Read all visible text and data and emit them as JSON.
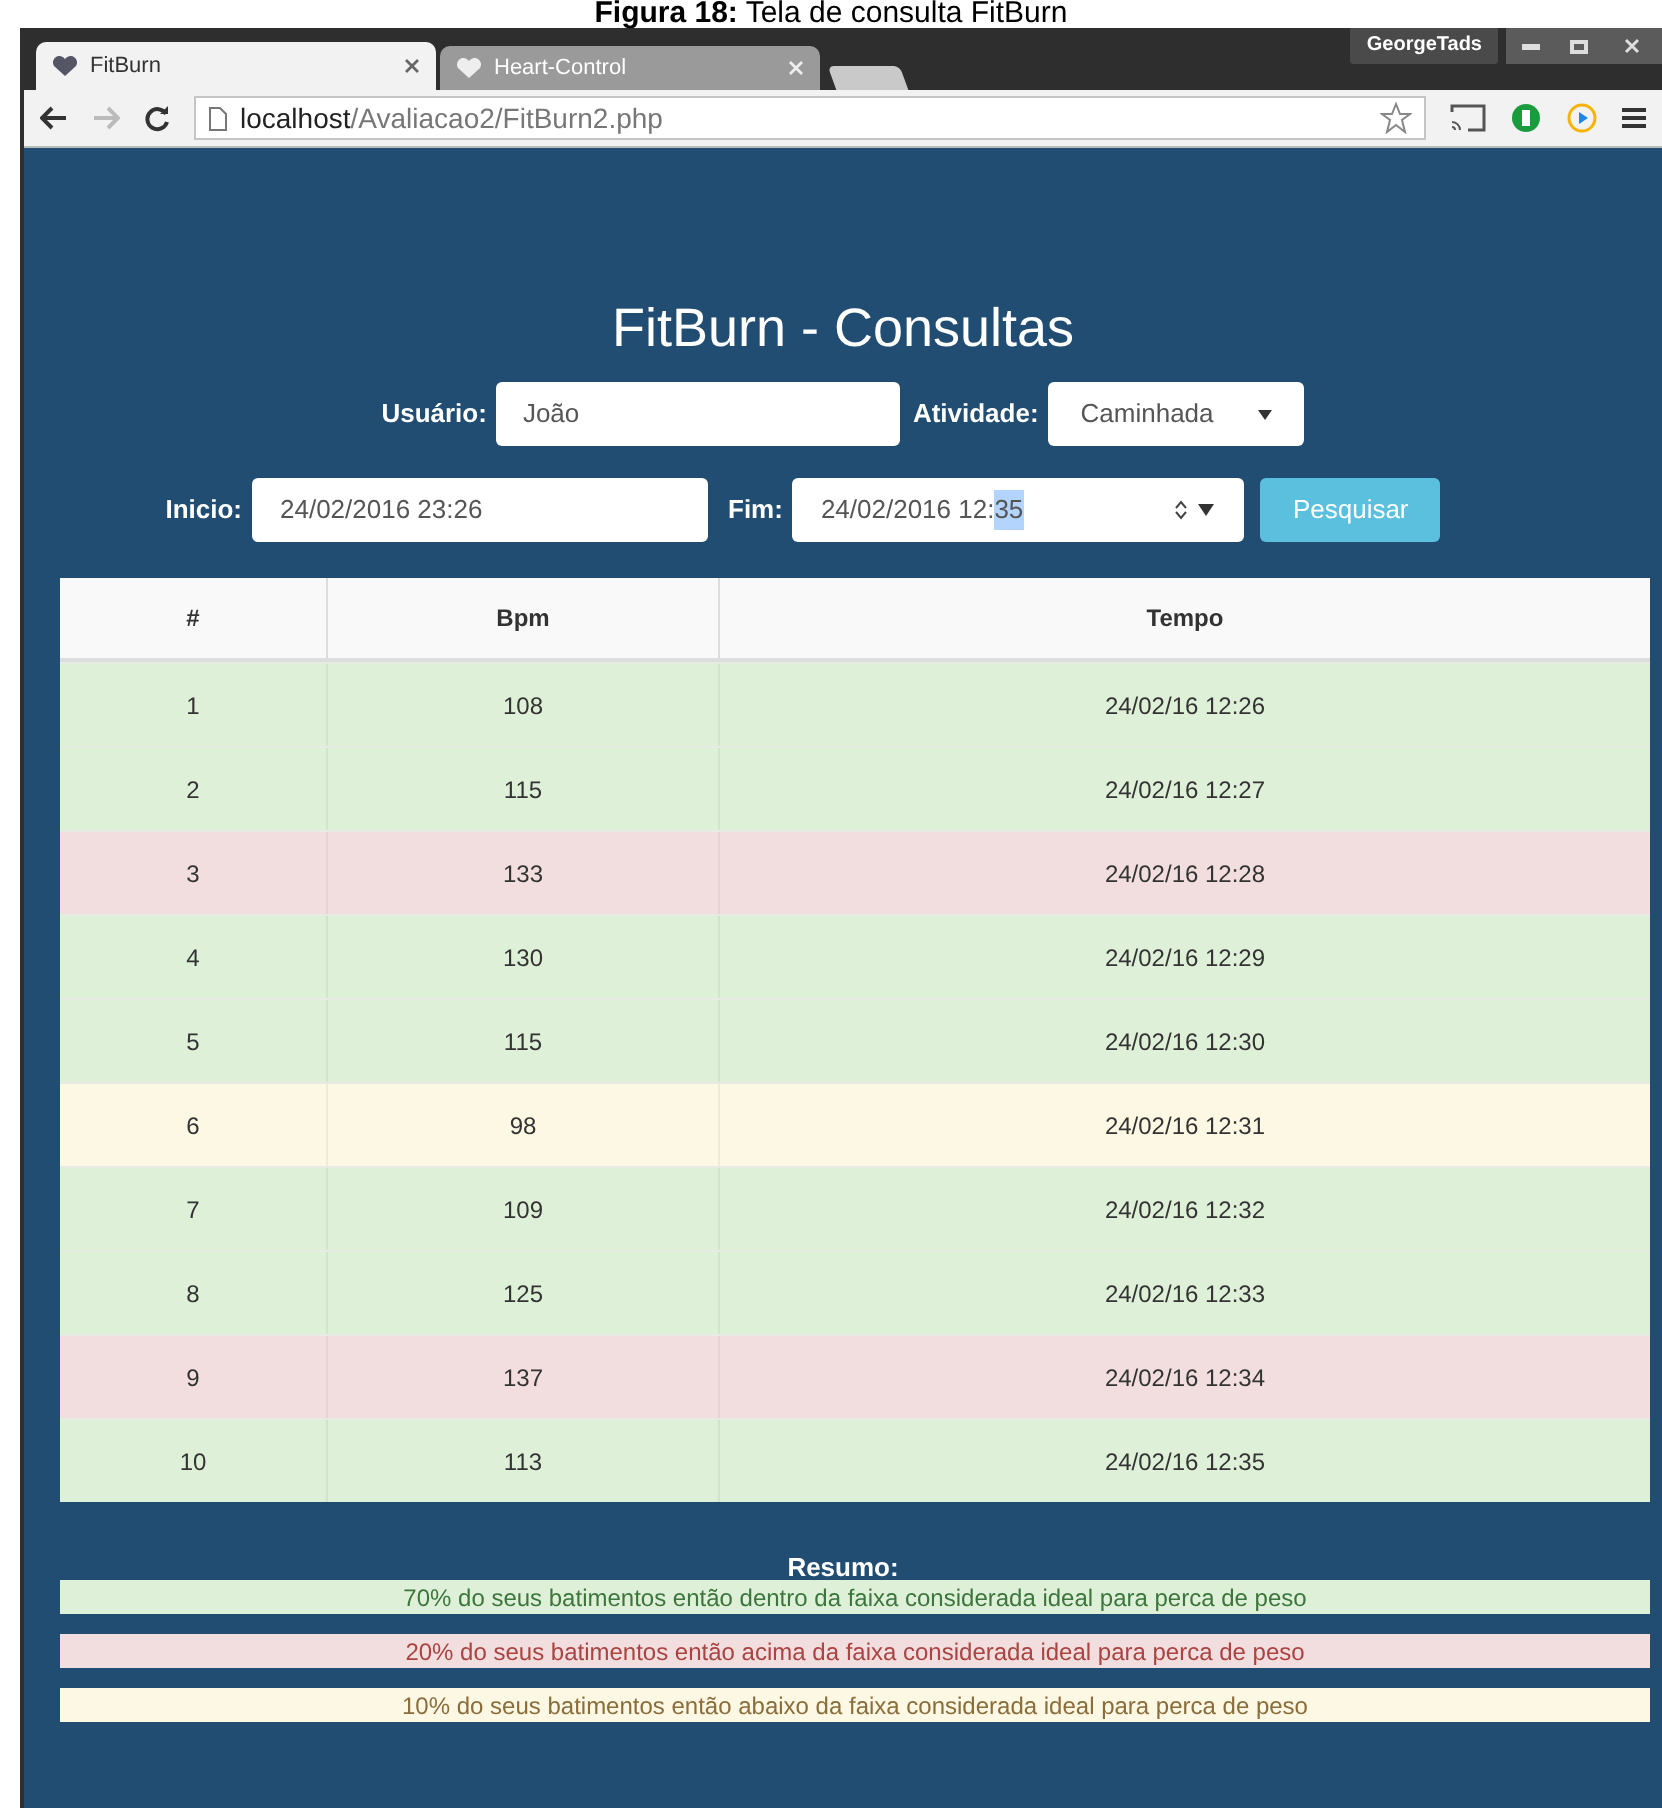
{
  "caption": "**Figura 18:** Tela de consulta FitBurn",
  "browser": {
    "tabs": [
      {
        "label": "FitBurn",
        "selected": true
      },
      {
        "label": "Heart-Control",
        "selected": false
      }
    ],
    "profile": "GeorgeTads",
    "address": {
      "host": "localhost",
      "path": "/Avaliacao2/FitBurn2.php"
    }
  },
  "page": {
    "title": "FitBurn - Consultas",
    "form": {
      "user": {
        "label": "Usuário:",
        "value": "João"
      },
      "activity": {
        "label": "Atividade:",
        "value": "Caminhada"
      },
      "start": {
        "label": "Inicio:",
        "value": "24/02/2016 23:26"
      },
      "end": {
        "label": "Fim:",
        "value": "24/02/2016 12:",
        "selected_text": "35"
      },
      "search_button": "Pesquisar"
    },
    "table": {
      "columns": [
        "#",
        "Bpm",
        "Tempo"
      ],
      "rows": [
        {
          "cells": [
            "1",
            "108",
            "24/02/16 12:26"
          ],
          "color": "#dff0d8"
        },
        {
          "cells": [
            "2",
            "115",
            "24/02/16 12:27"
          ],
          "color": "#dff0d8"
        },
        {
          "cells": [
            "3",
            "133",
            "24/02/16 12:28"
          ],
          "color": "#f2dede"
        },
        {
          "cells": [
            "4",
            "130",
            "24/02/16 12:29"
          ],
          "color": "#dff0d8"
        },
        {
          "cells": [
            "5",
            "115",
            "24/02/16 12:30"
          ],
          "color": "#dff0d8"
        },
        {
          "cells": [
            "6",
            "98",
            "24/02/16 12:31"
          ],
          "color": "#fcf8e3"
        },
        {
          "cells": [
            "7",
            "109",
            "24/02/16 12:32"
          ],
          "color": "#dff0d8"
        },
        {
          "cells": [
            "8",
            "125",
            "24/02/16 12:33"
          ],
          "color": "#dff0d8"
        },
        {
          "cells": [
            "9",
            "137",
            "24/02/16 12:34"
          ],
          "color": "#f2dede"
        },
        {
          "cells": [
            "10",
            "113",
            "24/02/16 12:35"
          ],
          "color": "#dff0d8"
        }
      ]
    },
    "summary": {
      "title": "Resumo:",
      "items": [
        {
          "text": "70% do seus batimentos então dentro da faixa considerada ideal para perca de peso",
          "color": "#dff0d8"
        },
        {
          "text": "20% do seus batimentos então acima da faixa considerada ideal para perca de peso",
          "color": "#f2dede"
        },
        {
          "text": "10% do seus batimentos então abaixo da faixa considerada ideal para perca de peso",
          "color": "#fcf8e3"
        }
      ]
    }
  }
}
